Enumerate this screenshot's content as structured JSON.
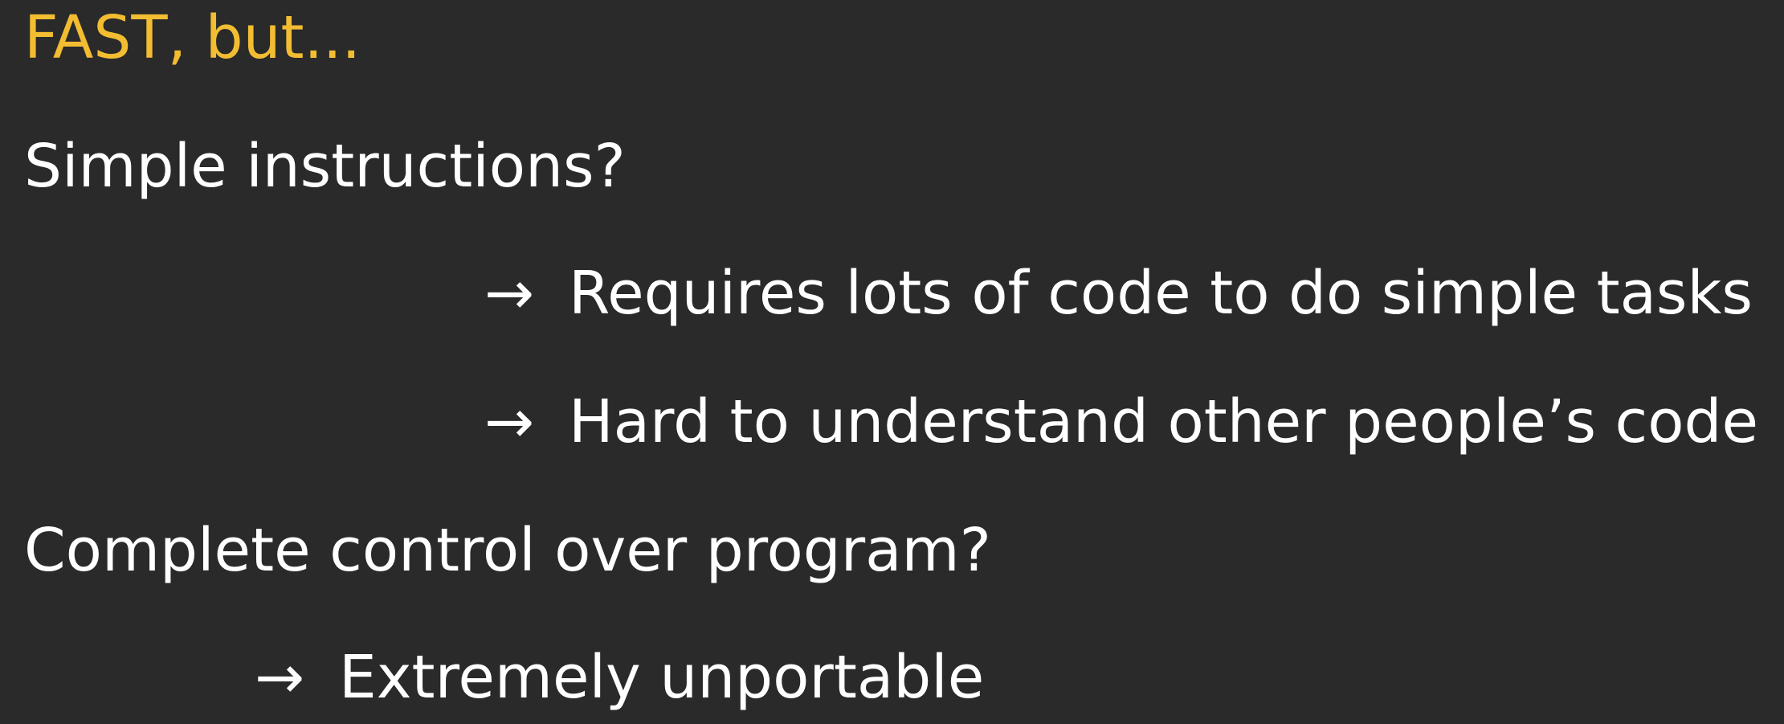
{
  "slide": {
    "title": "FAST, but...",
    "title_color": "#f2bd31",
    "text_color": "#ffffff",
    "background_color": "#2a2a2a",
    "items": [
      {
        "question": "Simple instructions?",
        "answers": [
          {
            "arrow": "→",
            "text": "Requires lots of code to do simple tasks"
          },
          {
            "arrow": "→",
            "text": "Hard to understand other people’s code"
          }
        ]
      },
      {
        "question": "Complete control over program?",
        "answers": [
          {
            "arrow": "→",
            "text": "Extremely unportable"
          }
        ]
      }
    ]
  }
}
